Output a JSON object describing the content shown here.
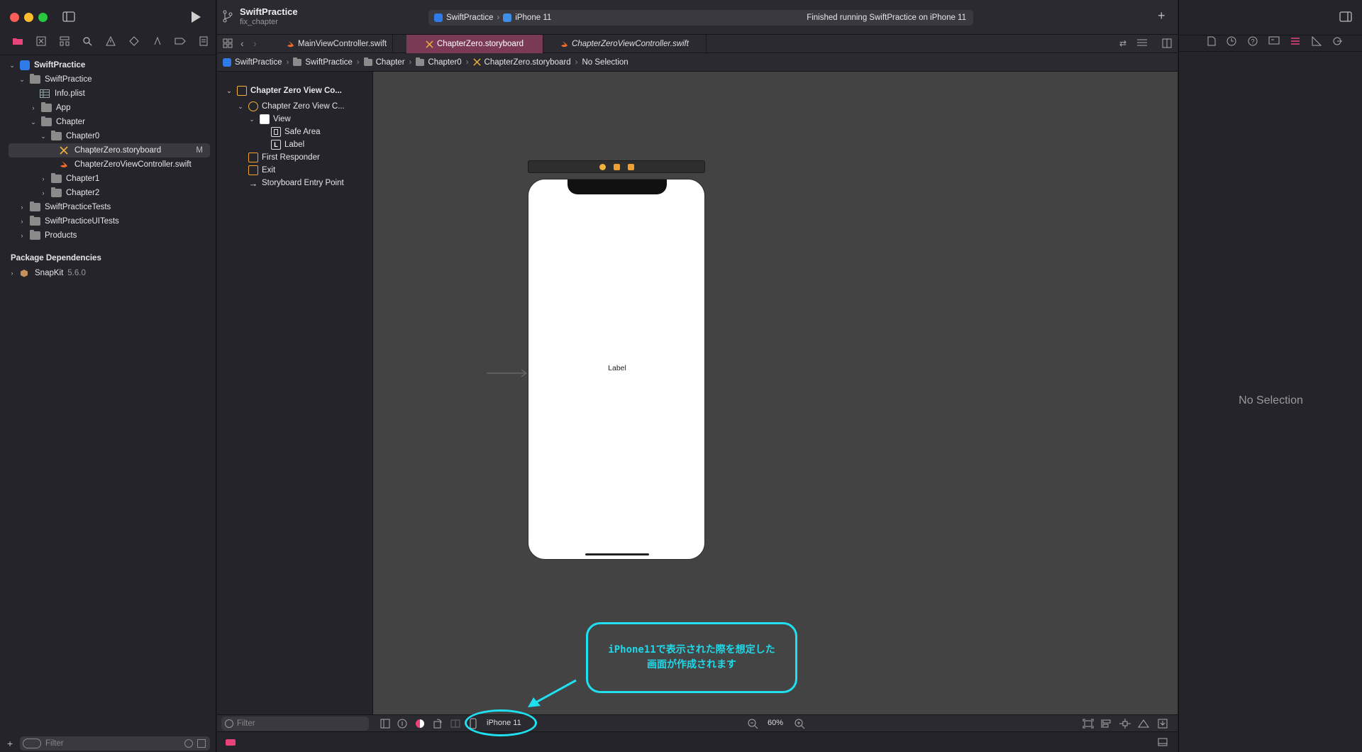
{
  "nav": {
    "items": [
      {
        "label": "SwiftPractice",
        "badge": ""
      },
      {
        "label": "SwiftPractice"
      },
      {
        "label": "Info.plist"
      },
      {
        "label": "App"
      },
      {
        "label": "Chapter"
      },
      {
        "label": "Chapter0"
      },
      {
        "label": "ChapterZero.storyboard",
        "badge": "M"
      },
      {
        "label": "ChapterZeroViewController.swift"
      },
      {
        "label": "Chapter1"
      },
      {
        "label": "Chapter2"
      },
      {
        "label": "SwiftPracticeTests"
      },
      {
        "label": "SwiftPracticeUITests"
      },
      {
        "label": "Products"
      }
    ],
    "package_header": "Package Dependencies",
    "package": {
      "name": "SnapKit",
      "version": "5.6.0"
    },
    "filter_placeholder": "Filter"
  },
  "toolbar": {
    "project": "SwiftPractice",
    "branch": "fix_chapter",
    "scheme": "SwiftPractice",
    "destination": "iPhone 11",
    "status": "Finished running SwiftPractice on iPhone 11"
  },
  "tabs": [
    {
      "label": "MainViewController.swift"
    },
    {
      "label": "ChapterZero.storyboard"
    },
    {
      "label": "ChapterZeroViewController.swift"
    }
  ],
  "jump_bar": [
    "SwiftPractice",
    "SwiftPractice",
    "Chapter",
    "Chapter0",
    "ChapterZero.storyboard",
    "No Selection"
  ],
  "outline": {
    "items": [
      {
        "label": "Chapter Zero View Co..."
      },
      {
        "label": "Chapter Zero View C..."
      },
      {
        "label": "View"
      },
      {
        "label": "Safe Area"
      },
      {
        "label": "Label"
      },
      {
        "label": "First Responder"
      },
      {
        "label": "Exit"
      },
      {
        "label": "Storyboard Entry Point"
      }
    ],
    "filter_placeholder": "Filter"
  },
  "canvas": {
    "label_text": "Label"
  },
  "bottom_bar": {
    "device": "iPhone 11",
    "zoom": "60%"
  },
  "inspector": {
    "empty": "No Selection"
  },
  "annotation": {
    "line1": "iPhone11で表示された際を想定した",
    "line2": "画面が作成されます"
  },
  "colors": {
    "accent": "#e8447a",
    "annotation": "#1fe0f0",
    "selected_tab": "#7a3a55"
  }
}
